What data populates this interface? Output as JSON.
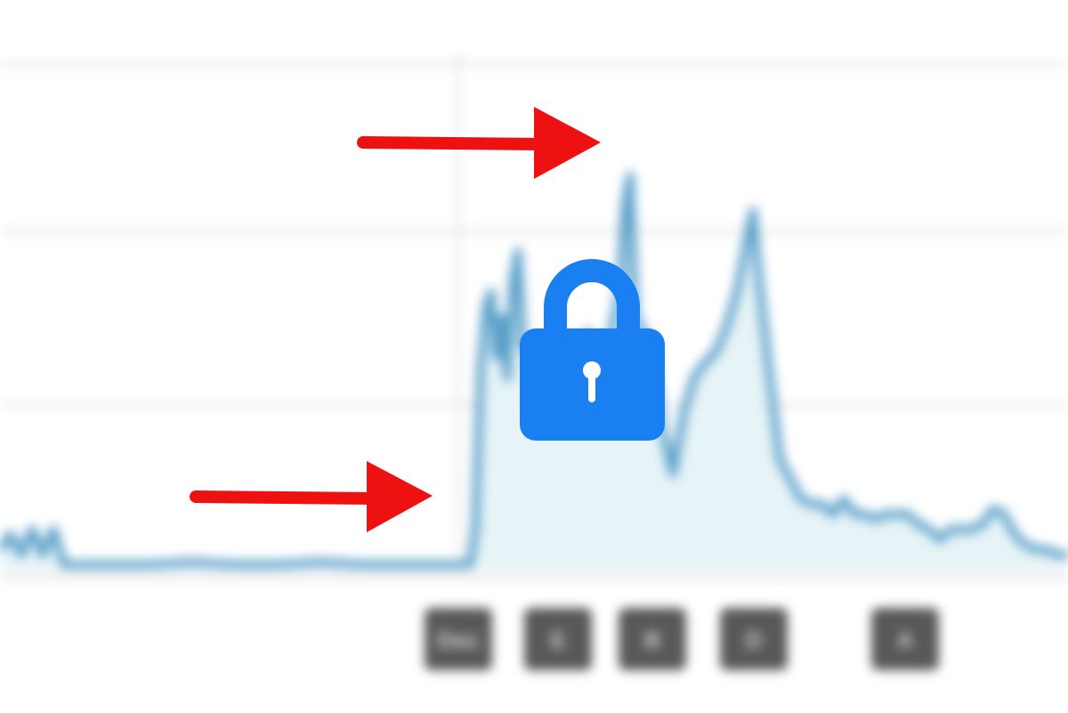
{
  "chart_data": {
    "type": "area",
    "title": "",
    "xlabel": "",
    "ylabel": "",
    "xlim": [
      0,
      100
    ],
    "ylim": [
      0,
      100
    ],
    "grid": true,
    "legend": "none",
    "series": [
      {
        "x": [
          0,
          1,
          2,
          3,
          4,
          5,
          6,
          8,
          10,
          14,
          18,
          22,
          26,
          30,
          34,
          38,
          42,
          44,
          44.5,
          45,
          45.5,
          46,
          46.5,
          47,
          47.5,
          48,
          48.5,
          49,
          49.5,
          50,
          50.5,
          51,
          51.5,
          52,
          53,
          54,
          55,
          56,
          57,
          58,
          58.5,
          59,
          59.5,
          60,
          61,
          62,
          63,
          64,
          65,
          66,
          67,
          68,
          69,
          70,
          70.5,
          71,
          72,
          73,
          74,
          75,
          76,
          77,
          78,
          79,
          80,
          81,
          82,
          83,
          84,
          85,
          86,
          87,
          88,
          89,
          90,
          91,
          92,
          93,
          94,
          95,
          96,
          97,
          98,
          99,
          100
        ],
        "values": [
          4,
          7,
          3,
          8,
          3,
          8,
          1,
          1,
          1,
          1,
          1.5,
          1,
          1,
          1.5,
          1,
          1,
          1,
          1,
          8,
          40,
          52,
          55,
          42,
          50,
          38,
          57,
          63,
          44,
          45,
          31,
          30,
          30,
          37,
          47,
          40,
          36,
          47,
          36,
          44,
          55,
          72,
          78,
          50,
          48,
          44,
          28,
          19,
          31,
          38,
          41,
          43,
          48,
          55,
          66,
          71,
          59,
          40,
          22,
          18,
          14,
          13,
          13,
          11,
          14,
          11,
          11,
          10,
          11,
          11,
          11,
          9,
          8,
          6,
          8,
          8,
          8,
          9,
          12,
          11,
          7,
          5,
          4,
          4,
          3,
          3
        ]
      }
    ],
    "color": "#5a9fc8",
    "fill": "#e6f3f7",
    "x_tick_labels": [
      "Dec",
      "E",
      "B",
      "D",
      "A"
    ]
  },
  "annotations": {
    "arrow_color": "#ee1111",
    "lock_icon": "lock-icon",
    "lock_color": "#1a7ff0"
  }
}
